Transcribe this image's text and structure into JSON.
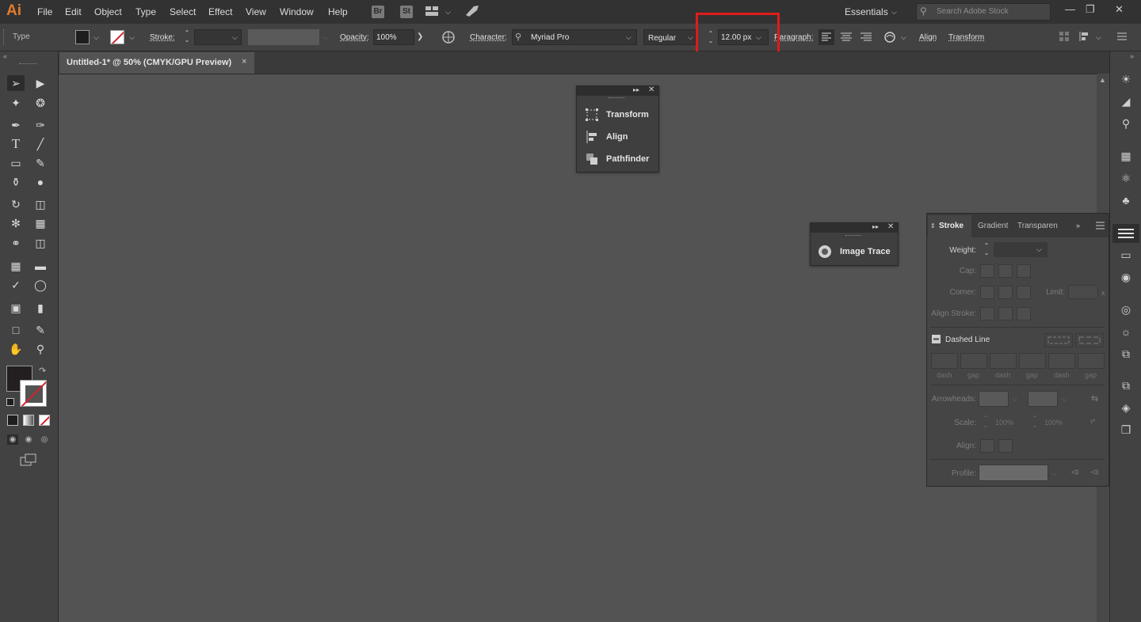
{
  "app": {
    "logo": "Ai"
  },
  "menu": [
    "File",
    "Edit",
    "Object",
    "Type",
    "Select",
    "Effect",
    "View",
    "Window",
    "Help"
  ],
  "menubar_icons": {
    "bridge": "Br",
    "stock": "St"
  },
  "workspace": {
    "label": "Essentials"
  },
  "search": {
    "placeholder": "Search Adobe Stock"
  },
  "control_bar": {
    "mode_label": "Type",
    "stroke_label": "Stroke:",
    "opacity_label": "Opacity:",
    "opacity_value": "100%",
    "character_label": "Character:",
    "font_family": "Myriad Pro",
    "font_style": "Regular",
    "font_size": "12.00 px",
    "paragraph_label": "Paragraph:",
    "align_link": "Align",
    "transform_link": "Transform"
  },
  "document_tab": {
    "title": "Untitled-1* @ 50% (CMYK/GPU Preview)",
    "close": "×"
  },
  "transform_panel": {
    "items": [
      "Transform",
      "Align",
      "Pathfinder"
    ]
  },
  "image_trace_panel": {
    "label": "Image Trace"
  },
  "stroke_panel": {
    "tabs": [
      "Stroke",
      "Gradient",
      "Transparen"
    ],
    "weight_label": "Weight:",
    "cap_label": "Cap:",
    "corner_label": "Corner:",
    "limit_label": "Limit:",
    "limit_suffix": "x",
    "align_stroke_label": "Align Stroke:",
    "dashed_line_label": "Dashed Line",
    "dash_labels": [
      "dash",
      "gap",
      "dash",
      "gap",
      "dash",
      "gap"
    ],
    "arrowheads_label": "Arrowheads:",
    "scale_label": "Scale:",
    "scale_values": [
      "100%",
      "100%"
    ],
    "align_label": "Align:",
    "profile_label": "Profile:"
  },
  "colors": {
    "highlight": "#e01b1b",
    "logo": "#e37b2f",
    "canvas": "#535353"
  }
}
